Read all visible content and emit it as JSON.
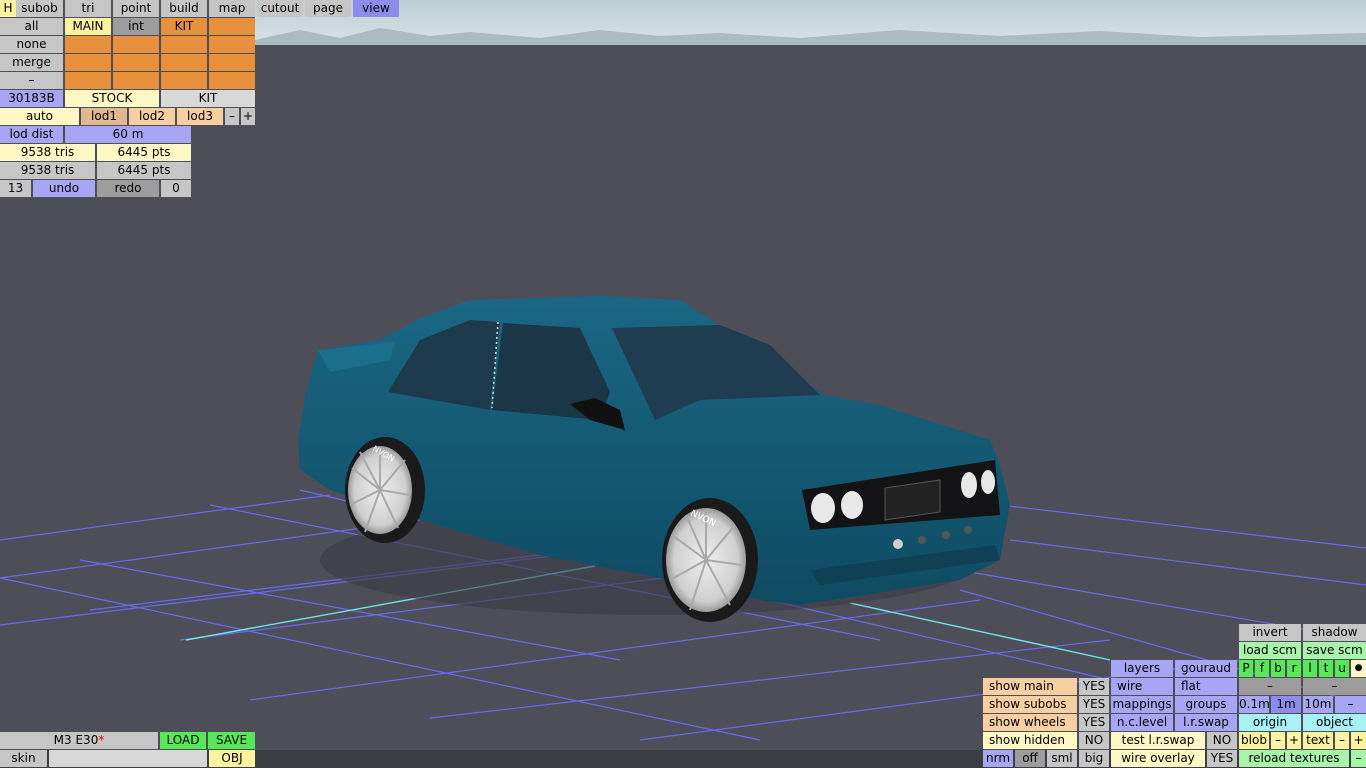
{
  "colors": {
    "background": "#4e4e58",
    "sky": "#c9d8dc",
    "car_body": "#13566f",
    "grid": "#6a6af0",
    "axis": "#6fe6e6"
  },
  "top_menu": {
    "h": "H",
    "items": [
      "subob",
      "tri",
      "point",
      "build",
      "map",
      "cutout",
      "page",
      "view"
    ],
    "active": "view"
  },
  "layers_panel": {
    "rows": [
      {
        "label": "all",
        "cells": [
          "MAIN",
          "int",
          "KIT",
          ""
        ]
      },
      {
        "label": "none",
        "cells": [
          "",
          "",
          "",
          ""
        ]
      },
      {
        "label": "merge",
        "cells": [
          "",
          "",
          "",
          ""
        ]
      },
      {
        "label": "–",
        "cells": [
          "",
          "",
          "",
          ""
        ]
      }
    ]
  },
  "kit_row": {
    "id": "30183B",
    "stock": "STOCK",
    "kit": "KIT"
  },
  "lod_row": {
    "auto": "auto",
    "lod1": "lod1",
    "lod2": "lod2",
    "lod3": "lod3",
    "minus": "–",
    "plus": "+"
  },
  "lod_dist": {
    "label": "lod dist",
    "value": "60 m"
  },
  "stats": [
    {
      "tris": "9538 tris",
      "pts": "6445 pts"
    },
    {
      "tris": "9538 tris",
      "pts": "6445 pts"
    }
  ],
  "undo_row": {
    "count": "13",
    "undo": "undo",
    "redo": "redo",
    "redo_count": "0"
  },
  "right_panel": {
    "invert": "invert",
    "shadow": "shadow",
    "load_scm": "load scm",
    "save_scm": "save scm",
    "layers": "layers",
    "gouraud": "gouraud",
    "flags": [
      "P",
      "f",
      "b",
      "r",
      "l",
      "t",
      "u",
      "●"
    ],
    "wire": "wire",
    "flat": "flat",
    "dash1": "–",
    "dash2": "–",
    "mappings": "mappings",
    "groups": "groups",
    "scale": [
      "0.1m",
      "1m",
      "10m",
      "–"
    ],
    "nclevel": "n.c.level",
    "lrswap": "l.r.swap",
    "origin": "origin",
    "object": "object",
    "test_lrswap": "test l.r.swap",
    "test_lrswap_val": "NO",
    "blob": "blob",
    "text": "text",
    "minus": "–",
    "plus": "+",
    "wire_overlay": "wire overlay",
    "wire_overlay_val": "YES",
    "reload_textures": "reload textures"
  },
  "show_panel": [
    {
      "label": "show main",
      "value": "YES"
    },
    {
      "label": "show subobs",
      "value": "YES"
    },
    {
      "label": "show wheels",
      "value": "YES"
    },
    {
      "label": "show hidden",
      "value": "NO"
    }
  ],
  "view_modes": [
    "nrm",
    "off",
    "sml",
    "big"
  ],
  "file_panel": {
    "name": "M3 E30",
    "modified_mark": "*",
    "load": "LOAD",
    "save": "SAVE",
    "skin": "skin",
    "obj": "OBJ"
  },
  "scene": {
    "tire_text": "NVON"
  }
}
